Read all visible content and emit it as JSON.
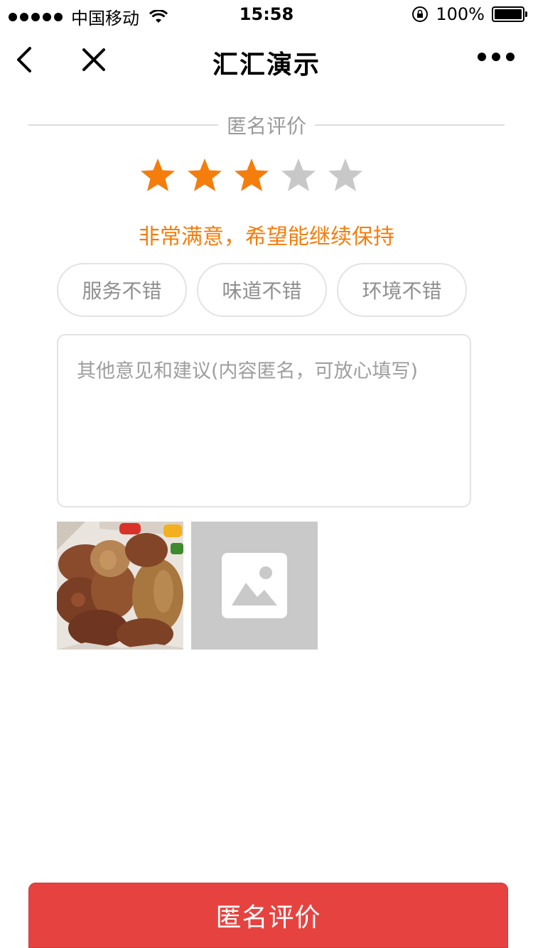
{
  "status_bar": {
    "carrier": "中国移动",
    "time": "15:58",
    "battery": "100%"
  },
  "nav": {
    "title": "汇汇演示"
  },
  "section": {
    "header_label": "匿名评价"
  },
  "rating": {
    "value": 3,
    "max": 5,
    "text": "非常满意，希望能继续保持",
    "active_color": "#f47d0c",
    "inactive_color": "#c8c8c8"
  },
  "tags": [
    {
      "label": "服务不错"
    },
    {
      "label": "味道不错"
    },
    {
      "label": "环境不错"
    }
  ],
  "comment": {
    "placeholder": "其他意见和建议(内容匿名，可放心填写)"
  },
  "photos": {
    "items": [
      "food-photo"
    ],
    "add_icon": "image-placeholder-icon"
  },
  "submit": {
    "label": "匿名评价",
    "color": "#e64340"
  }
}
